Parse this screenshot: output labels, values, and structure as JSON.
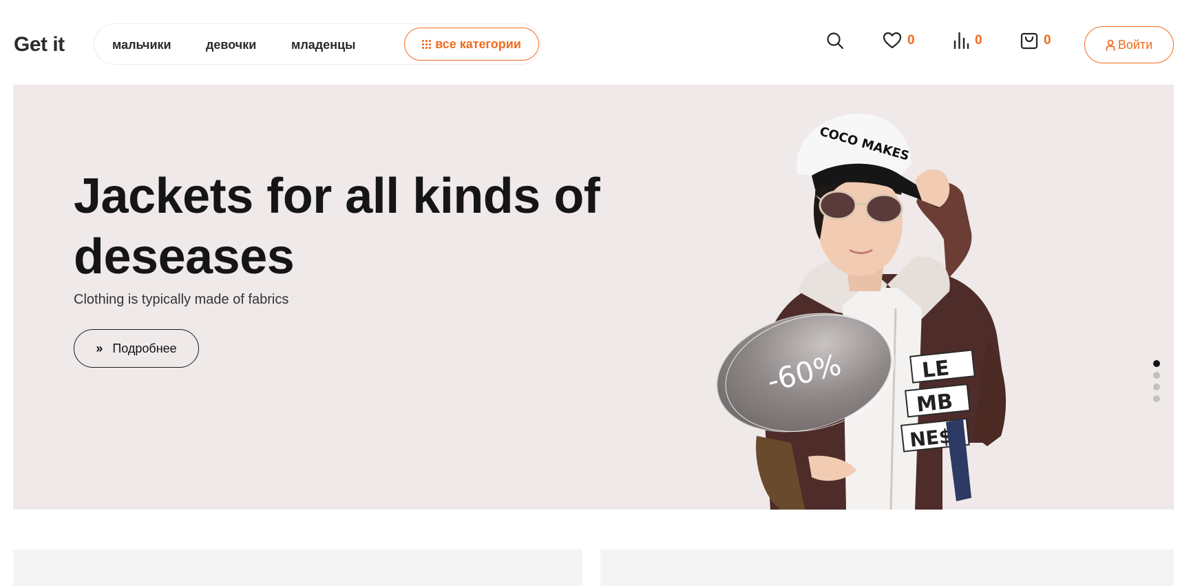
{
  "header": {
    "logo": "Get it",
    "nav": [
      {
        "label": "мальчики"
      },
      {
        "label": "девочки"
      },
      {
        "label": "младенцы"
      }
    ],
    "categories_button": "все категории",
    "favorites_count": "0",
    "compare_count": "0",
    "cart_count": "0",
    "login_label": "Войти"
  },
  "hero": {
    "title": "Jackets for all kinds of deseases",
    "subtitle": "Clothing is typically made of fabrics",
    "button_label": "Подробнее",
    "badge": "-60%",
    "cap_text": "COCO MAKES",
    "shirt_text": [
      "LE",
      "MB",
      "NE$$"
    ],
    "slides": 4,
    "active_slide": 1
  },
  "colors": {
    "accent": "#f26a1b",
    "hero_bg": "#efe9e9",
    "card_bg": "#f4f4f4"
  },
  "icons": [
    "search-icon",
    "heart-icon",
    "compare-icon",
    "cart-icon",
    "user-icon",
    "grid-icon",
    "double-chevron-icon"
  ]
}
